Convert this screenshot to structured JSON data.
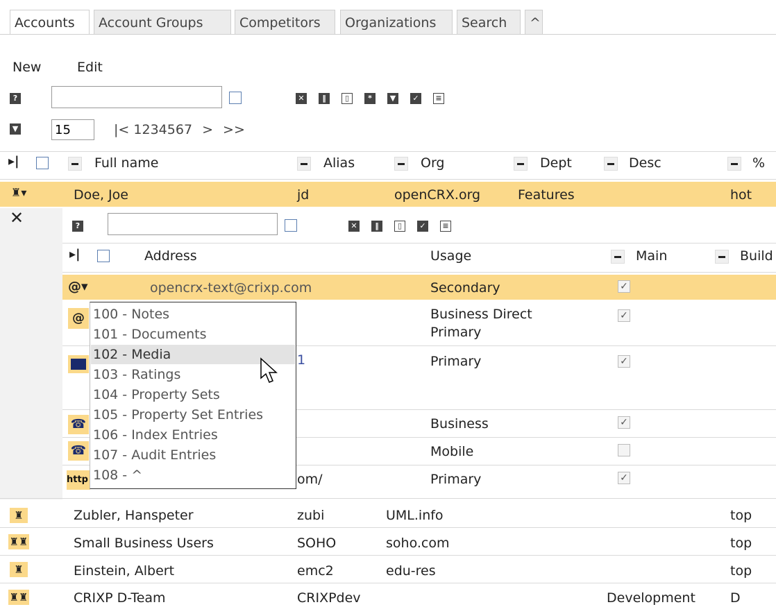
{
  "tabs": [
    "Accounts",
    "Account Groups",
    "Competitors",
    "Organizations",
    "Search",
    "^"
  ],
  "menu": {
    "new": "New",
    "edit": "Edit"
  },
  "filter": {
    "value": "",
    "placeholder": ""
  },
  "paging": {
    "page_size": "15",
    "first": "|<",
    "pages": [
      "1",
      "2",
      "3",
      "4",
      "5",
      "6",
      "7"
    ],
    "next": ">",
    "last": ">>"
  },
  "columns": [
    "Full name",
    "Alias",
    "Org",
    "Dept",
    "Desc",
    "%"
  ],
  "expanded_row": {
    "full_name": "Doe, Joe",
    "alias": "jd",
    "org": "openCRX.org",
    "dept": "Features",
    "pct": "hot"
  },
  "sub_table": {
    "columns": [
      "Address",
      "Usage",
      "Main",
      "Build"
    ],
    "rows": [
      {
        "address": "opencrx-text@crixp.com",
        "usage": "Secondary",
        "main": true
      },
      {
        "address": "",
        "usage": "Business Direct",
        "usage2": "Primary",
        "main": true
      },
      {
        "address": "",
        "usage": "Primary",
        "main": true
      },
      {
        "address": "",
        "usage": "Business",
        "main": true
      },
      {
        "address": "",
        "usage": "Mobile",
        "main": false
      },
      {
        "address": "om/",
        "usage": "Primary",
        "main": true
      }
    ]
  },
  "dropdown": [
    "100 - Notes",
    "101 - Documents",
    "102 - Media",
    "103 - Ratings",
    "104 - Property Sets",
    "105 - Property Set Entries",
    "106 - Index Entries",
    "107 - Audit Entries",
    "108 - ^"
  ],
  "rows": [
    {
      "full_name": "Zubler, Hanspeter",
      "alias": "zubi",
      "org": "UML.info",
      "dept": "",
      "pct": "top"
    },
    {
      "full_name": "Small Business Users",
      "alias": "SOHO",
      "org": "soho.com",
      "dept": "",
      "pct": "top"
    },
    {
      "full_name": "Einstein, Albert",
      "alias": "emc2",
      "org": "edu-res",
      "dept": "",
      "pct": "top"
    },
    {
      "full_name": "CRIXP D-Team",
      "alias": "CRIXPdev",
      "org": "",
      "dept": "Development",
      "pct": "D"
    }
  ],
  "icons": {
    "help": "help-icon",
    "collapse": "collapse-icon",
    "close": "close-icon",
    "at": "at-icon",
    "phone": "phone-icon",
    "web": "web-icon",
    "card": "card-icon",
    "person": "person-icon",
    "group": "group-icon"
  },
  "colors": {
    "highlight": "#fbd98a",
    "row_hover": "#e3e3e3",
    "checkbox_border": "#5b7eb0"
  }
}
